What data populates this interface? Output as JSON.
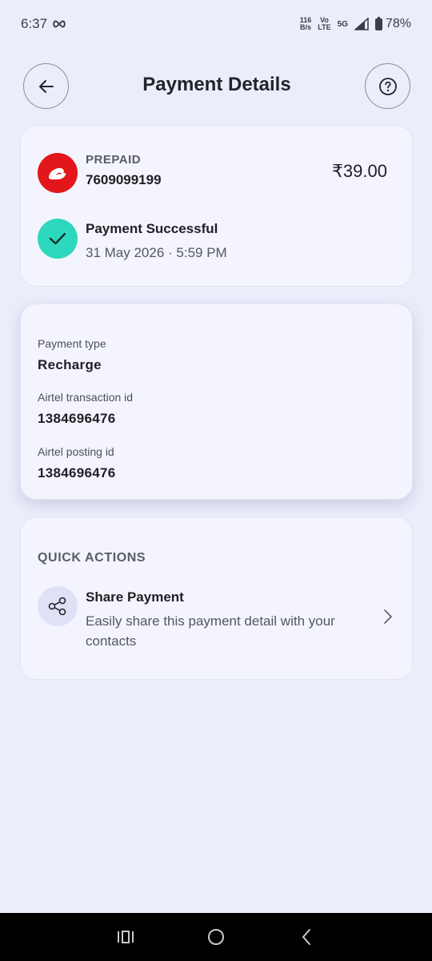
{
  "status_bar": {
    "time": "6:37",
    "data_speed_top": "116",
    "data_speed_unit": "B/s",
    "volte_top": "Vo",
    "volte_bottom": "LTE",
    "network": "5G",
    "battery": "78%"
  },
  "header": {
    "title": "Payment Details",
    "back_icon": "arrow-left-icon",
    "help_icon": "question-circle-icon"
  },
  "summary": {
    "plan_type": "PREPAID",
    "number": "7609099199",
    "amount": "₹39.00",
    "status": "Payment Successful",
    "date_time": "31 May 2026 · 5:59 PM"
  },
  "details": [
    {
      "label": "Payment type",
      "value": "Recharge"
    },
    {
      "label": "Airtel transaction id",
      "value": "1384696476"
    },
    {
      "label": "Airtel posting id",
      "value": "1384696476"
    }
  ],
  "quick_actions": {
    "heading": "QUICK ACTIONS",
    "items": [
      {
        "title": "Share Payment",
        "description": "Easily share this payment detail with your contacts",
        "icon": "share-icon"
      }
    ]
  },
  "colors": {
    "background": "#ecedfb",
    "card": "#f3f4fd",
    "airtel_red": "#e2161b",
    "success_teal": "#2ed8bd"
  }
}
